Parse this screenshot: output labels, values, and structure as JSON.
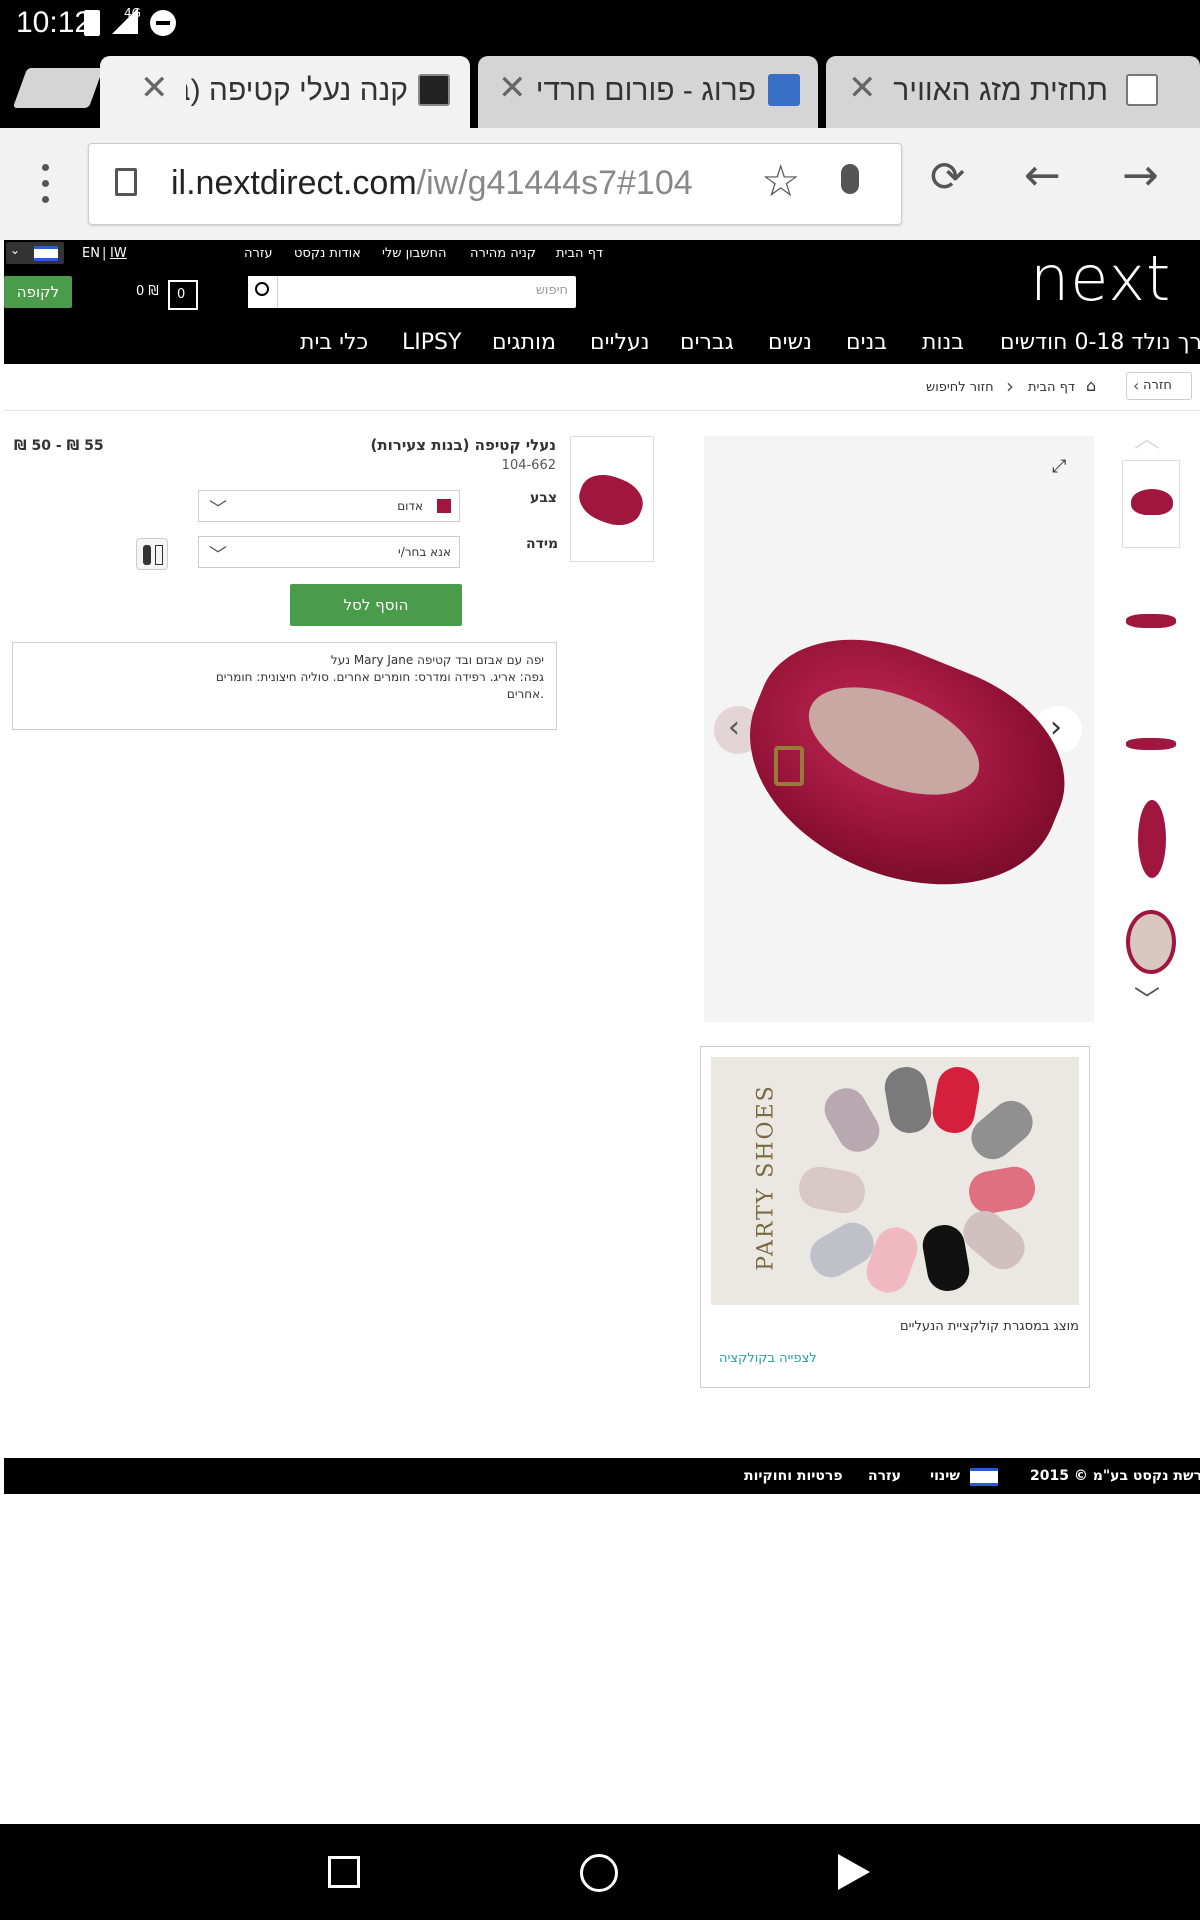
{
  "status_bar": {
    "time": "10:12",
    "network": "4G"
  },
  "browser": {
    "tabs": [
      {
        "title": "קנה נעלי קטיפה (בנ",
        "active": true
      },
      {
        "title": "פרוג - פורום חרדי מ",
        "active": false
      },
      {
        "title": "תחזית מזג האוויר ה",
        "active": false
      }
    ],
    "url_host": "il.nextdirect.com",
    "url_path": "/iw/g41444s7#104"
  },
  "site": {
    "logo": "next",
    "top_links": [
      "דף הבית",
      "קניה מהירה",
      "החשבון שלי",
      "אודות נקסט",
      "עזרה"
    ],
    "lang_en": "EN",
    "lang_iw": "IW",
    "search_placeholder": "חיפוש",
    "bag_count": "0",
    "bag_total": "0 ₪",
    "checkout_label": "לקופה",
    "nav": [
      "רך נולד 0-18 חודשים",
      "בנות",
      "בנים",
      "נשים",
      "גברים",
      "נעליים",
      "מותגים",
      "LIPSY",
      "כלי בית"
    ]
  },
  "breadcrumb": {
    "back": "חזרה",
    "home": "דף הבית",
    "back_to_search": "חזור לחיפוש"
  },
  "product": {
    "title": "נעלי קטיפה (בנות צעירות)",
    "code": "104-662",
    "price": "55 ₪ - 50 ₪",
    "color_label": "צבע",
    "color_value": "אדום",
    "size_label": "מידה",
    "size_value": "אנא בחר/י",
    "add_to_bag": "הוסף לסל",
    "description_line1": "נעל Mary Jane יפה עם אבזם ובד קטיפה",
    "description_line2": "גפה: אריג. רפידה ומדרס: חומרים אחרים. סוליה חיצונית: חומרים",
    "description_line3": "אחרים.",
    "accent_color": "#a0163f"
  },
  "promo": {
    "image_text": "PARTY SHOES",
    "caption": "מוצג במסגרת קולקציית הנעליים",
    "link": "לצפייה בקולקציה"
  },
  "footer": {
    "copyright": "רשת נקסט בע\"מ © 2015",
    "change": "שינוי",
    "help": "עזרה",
    "privacy": "פרטיות וחוקיות"
  }
}
